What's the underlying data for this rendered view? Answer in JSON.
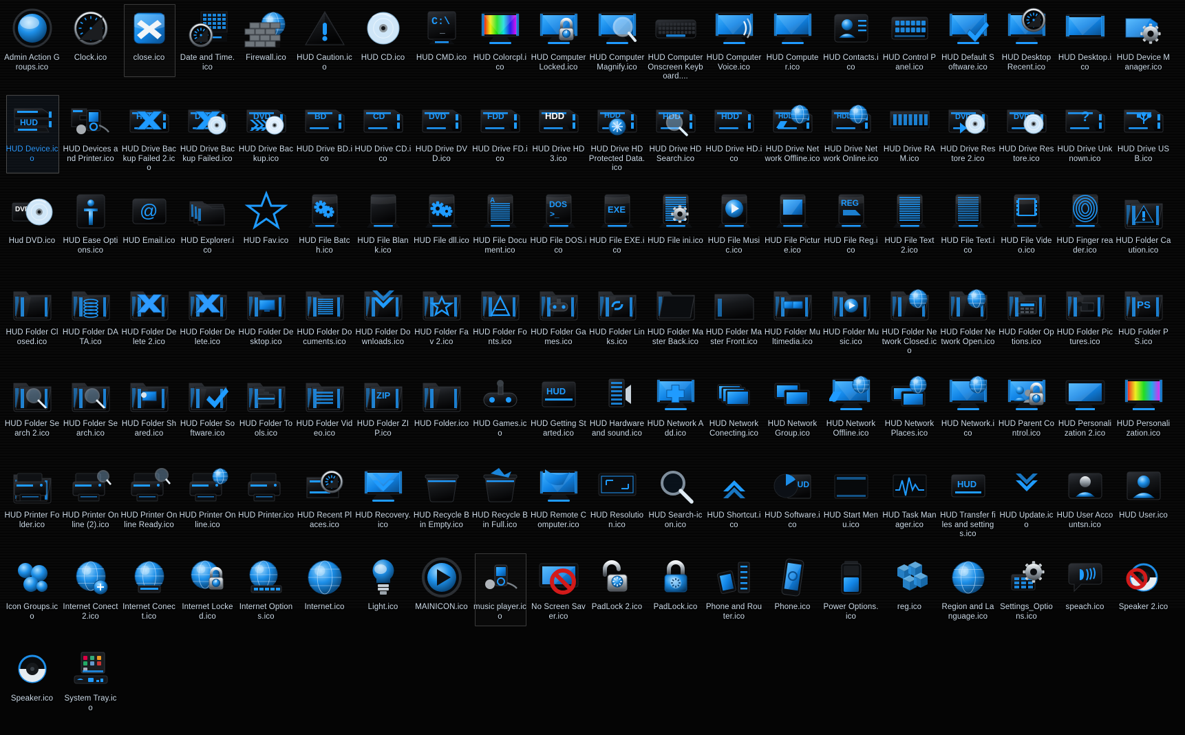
{
  "view": {
    "name": "icon-folder-grid",
    "background_color": "#060606",
    "label_color": "#cddbe8",
    "selected_label_color": "#2e9bff",
    "columns": 20,
    "rows": 7,
    "total_items": 140
  },
  "icons": [
    {
      "label": "Admin Action Groups.ico",
      "glyph": "orb-blue",
      "state": "normal"
    },
    {
      "label": "Clock.ico",
      "glyph": "clock",
      "state": "normal"
    },
    {
      "label": "close.ico",
      "glyph": "close-x",
      "state": "selected"
    },
    {
      "label": "Date and Time.ico",
      "glyph": "calendar-clock",
      "state": "normal"
    },
    {
      "label": "Firewall.ico",
      "glyph": "firewall-brick",
      "state": "normal"
    },
    {
      "label": "HUD Caution.ico",
      "glyph": "caution-triangle",
      "state": "normal"
    },
    {
      "label": "HUD CD.ico",
      "glyph": "disc",
      "state": "normal"
    },
    {
      "label": "HUD CMD.ico",
      "glyph": "cmd-prompt",
      "state": "normal"
    },
    {
      "label": "HUD Colorcpl.ico",
      "glyph": "monitor-rainbow",
      "state": "normal"
    },
    {
      "label": "HUD Computer Locked.ico",
      "glyph": "monitor-lock",
      "state": "normal"
    },
    {
      "label": "HUD Computer Magnify.ico",
      "glyph": "monitor-magnify",
      "state": "normal"
    },
    {
      "label": "HUD Computer Onscreen Keyboard....",
      "glyph": "keyboard",
      "state": "normal"
    },
    {
      "label": "HUD Computer Voice.ico",
      "glyph": "monitor-voice",
      "state": "normal"
    },
    {
      "label": "HUD Computer.ico",
      "glyph": "monitor",
      "state": "normal"
    },
    {
      "label": "HUD Contacts.ico",
      "glyph": "contacts",
      "state": "normal"
    },
    {
      "label": "HUD Control Panel.ico",
      "glyph": "control-panel",
      "state": "normal"
    },
    {
      "label": "HUD Default Software.ico",
      "glyph": "monitor-check",
      "state": "normal"
    },
    {
      "label": "HUD Desktop Recent.ico",
      "glyph": "monitor-clock",
      "state": "normal"
    },
    {
      "label": "HUD Desktop.ico",
      "glyph": "monitor-plain",
      "state": "normal"
    },
    {
      "label": "HUD Device Manager.ico",
      "glyph": "device-gear",
      "state": "normal"
    },
    {
      "label": "HUD Device.ico",
      "glyph": "hud-device",
      "state": "active"
    },
    {
      "label": "HUD Devices and Printer.ico",
      "glyph": "devices-printer",
      "state": "normal"
    },
    {
      "label": "HUD Drive Backup Failed 2.ico",
      "glyph": "drive-hdd-x",
      "state": "normal"
    },
    {
      "label": "HUD Drive Backup Failed.ico",
      "glyph": "drive-dvd-x",
      "state": "normal"
    },
    {
      "label": "HUD Drive Backup.ico",
      "glyph": "drive-dvd-arrows",
      "state": "normal"
    },
    {
      "label": "HUD Drive BD.ico",
      "glyph": "drive-bd",
      "state": "normal"
    },
    {
      "label": "HUD Drive CD.ico",
      "glyph": "drive-cd",
      "state": "normal"
    },
    {
      "label": "HUD Drive DVD.ico",
      "glyph": "drive-dvd",
      "state": "normal"
    },
    {
      "label": "HUD Drive FD.ico",
      "glyph": "drive-fd",
      "state": "normal"
    },
    {
      "label": "HUD Drive HD 3.ico",
      "glyph": "drive-hdd3",
      "state": "normal"
    },
    {
      "label": "HUD Drive HD Protected Data.ico",
      "glyph": "drive-hdd-shield",
      "state": "normal"
    },
    {
      "label": "HUD Drive HD Search.ico",
      "glyph": "drive-hdd-search",
      "state": "normal"
    },
    {
      "label": "HUD Drive HD.ico",
      "glyph": "drive-hdd",
      "state": "normal"
    },
    {
      "label": "HUD Drive Network Offline.ico",
      "glyph": "drive-net-off",
      "state": "normal"
    },
    {
      "label": "HUD Drive Network Online.ico",
      "glyph": "drive-net-on",
      "state": "normal"
    },
    {
      "label": "HUD Drive RAM.ico",
      "glyph": "drive-ram",
      "state": "normal"
    },
    {
      "label": "HUD Drive Restore 2.ico",
      "glyph": "drive-restore2",
      "state": "normal"
    },
    {
      "label": "HUD Drive Restore.ico",
      "glyph": "drive-restore",
      "state": "normal"
    },
    {
      "label": "HUD Drive Unknown.ico",
      "glyph": "drive-unknown",
      "state": "normal"
    },
    {
      "label": "HUD Drive USB.ico",
      "glyph": "drive-usb",
      "state": "normal"
    },
    {
      "label": "Hud DVD.ico",
      "glyph": "dvd-disc",
      "state": "normal"
    },
    {
      "label": "HUD Ease Options.ico",
      "glyph": "ease-access",
      "state": "normal"
    },
    {
      "label": "HUD Email.ico",
      "glyph": "email-at",
      "state": "normal"
    },
    {
      "label": "HUD Explorer.ico",
      "glyph": "explorer-stack",
      "state": "normal"
    },
    {
      "label": "HUD Fav.ico",
      "glyph": "star",
      "state": "normal"
    },
    {
      "label": "HUD File Batch.ico",
      "glyph": "file-batch",
      "state": "normal"
    },
    {
      "label": "HUD File Blank.ico",
      "glyph": "file-blank",
      "state": "normal"
    },
    {
      "label": "HUD File dll.ico",
      "glyph": "file-dll",
      "state": "normal"
    },
    {
      "label": "HUD File Document.ico",
      "glyph": "file-doc",
      "state": "normal"
    },
    {
      "label": "HUD File DOS.ico",
      "glyph": "file-dos",
      "state": "normal"
    },
    {
      "label": "HUD File EXE.ico",
      "glyph": "file-exe",
      "state": "normal"
    },
    {
      "label": "HUD File ini.ico",
      "glyph": "file-ini",
      "state": "normal"
    },
    {
      "label": "HUD File Music.ico",
      "glyph": "file-music",
      "state": "normal"
    },
    {
      "label": "HUD File Picture.ico",
      "glyph": "file-picture",
      "state": "normal"
    },
    {
      "label": "HUD File Reg.ico",
      "glyph": "file-reg",
      "state": "normal"
    },
    {
      "label": "HUD File Text 2.ico",
      "glyph": "file-text2",
      "state": "normal"
    },
    {
      "label": "HUD File Text.ico",
      "glyph": "file-text",
      "state": "normal"
    },
    {
      "label": "HUD File Video.ico",
      "glyph": "file-video",
      "state": "normal"
    },
    {
      "label": "HUD Finger reader.ico",
      "glyph": "fingerprint",
      "state": "normal"
    },
    {
      "label": "HUD Folder Caution.ico",
      "glyph": "folder-caution",
      "state": "normal"
    },
    {
      "label": "HUD Folder Closed.ico",
      "glyph": "folder-closed",
      "state": "normal"
    },
    {
      "label": "HUD Folder DATA.ico",
      "glyph": "folder-data",
      "state": "normal"
    },
    {
      "label": "HUD Folder Delete 2.ico",
      "glyph": "folder-delete2",
      "state": "normal"
    },
    {
      "label": "HUD Folder Delete.ico",
      "glyph": "folder-delete",
      "state": "normal"
    },
    {
      "label": "HUD Folder Desktop.ico",
      "glyph": "folder-desktop",
      "state": "normal"
    },
    {
      "label": "HUD Folder Documents.ico",
      "glyph": "folder-documents",
      "state": "normal"
    },
    {
      "label": "HUD Folder Downloads.ico",
      "glyph": "folder-downloads",
      "state": "normal"
    },
    {
      "label": "HUD Folder Fav 2.ico",
      "glyph": "folder-fav",
      "state": "normal"
    },
    {
      "label": "HUD Folder Fonts.ico",
      "glyph": "folder-fonts",
      "state": "normal"
    },
    {
      "label": "HUD Folder Games.ico",
      "glyph": "folder-games",
      "state": "normal"
    },
    {
      "label": "HUD Folder Links.ico",
      "glyph": "folder-links",
      "state": "normal"
    },
    {
      "label": "HUD Folder Master Back.ico",
      "glyph": "folder-master-back",
      "state": "normal"
    },
    {
      "label": "HUD Folder Master Front.ico",
      "glyph": "folder-master-front",
      "state": "normal"
    },
    {
      "label": "HUD Folder Multimedia.ico",
      "glyph": "folder-multimedia",
      "state": "normal"
    },
    {
      "label": "HUD Folder Music.ico",
      "glyph": "folder-music",
      "state": "normal"
    },
    {
      "label": "HUD Folder Network Closed.ico",
      "glyph": "folder-net-closed",
      "state": "normal"
    },
    {
      "label": "HUD Folder Network Open.ico",
      "glyph": "folder-net-open",
      "state": "normal"
    },
    {
      "label": "HUD Folder Options.ico",
      "glyph": "folder-options",
      "state": "normal"
    },
    {
      "label": "HUD Folder Pictures.ico",
      "glyph": "folder-pictures",
      "state": "normal"
    },
    {
      "label": "HUD Folder PS.ico",
      "glyph": "folder-ps",
      "state": "normal"
    },
    {
      "label": "HUD Folder Search 2.ico",
      "glyph": "folder-search2",
      "state": "normal"
    },
    {
      "label": "HUD Folder Search.ico",
      "glyph": "folder-search",
      "state": "normal"
    },
    {
      "label": "HUD Folder Shared.ico",
      "glyph": "folder-shared",
      "state": "normal"
    },
    {
      "label": "HUD Folder Software.ico",
      "glyph": "folder-software",
      "state": "normal"
    },
    {
      "label": "HUD Folder Tools.ico",
      "glyph": "folder-tools",
      "state": "normal"
    },
    {
      "label": "HUD Folder Video.ico",
      "glyph": "folder-video",
      "state": "normal"
    },
    {
      "label": "HUD Folder ZIP.ico",
      "glyph": "folder-zip",
      "state": "normal"
    },
    {
      "label": "HUD Folder.ico",
      "glyph": "folder",
      "state": "normal"
    },
    {
      "label": "HUD Games.ico",
      "glyph": "gamepad",
      "state": "normal"
    },
    {
      "label": "HUD Getting Started.ico",
      "glyph": "getting-started",
      "state": "normal"
    },
    {
      "label": "HUD Hardware and sound.ico",
      "glyph": "hardware-sound",
      "state": "normal"
    },
    {
      "label": "HUD Network Add.ico",
      "glyph": "network-add",
      "state": "normal"
    },
    {
      "label": "HUD Network Conecting.ico",
      "glyph": "network-connecting",
      "state": "normal"
    },
    {
      "label": "HUD Network Group.ico",
      "glyph": "network-group",
      "state": "normal"
    },
    {
      "label": "HUD Network Offline.ico",
      "glyph": "network-offline",
      "state": "normal"
    },
    {
      "label": "HUD Network Places.ico",
      "glyph": "network-places",
      "state": "normal"
    },
    {
      "label": "HUD Network.ico",
      "glyph": "network",
      "state": "normal"
    },
    {
      "label": "HUD Parent Control.ico",
      "glyph": "parent-control",
      "state": "normal"
    },
    {
      "label": "HUD Personalization 2.ico",
      "glyph": "personalization2",
      "state": "normal"
    },
    {
      "label": "HUD Personalization.ico",
      "glyph": "personalization",
      "state": "normal"
    },
    {
      "label": "HUD Printer Folder.ico",
      "glyph": "printer-folder",
      "state": "normal"
    },
    {
      "label": "HUD Printer Online (2).ico",
      "glyph": "printer-online2",
      "state": "normal"
    },
    {
      "label": "HUD Printer Online Ready.ico",
      "glyph": "printer-ready",
      "state": "normal"
    },
    {
      "label": "HUD Printer Online.ico",
      "glyph": "printer-online",
      "state": "normal"
    },
    {
      "label": "HUD Printer.ico",
      "glyph": "printer",
      "state": "normal"
    },
    {
      "label": "HUD Recent Places.ico",
      "glyph": "recent-places",
      "state": "normal"
    },
    {
      "label": "HUD Recovery.ico",
      "glyph": "recovery",
      "state": "normal"
    },
    {
      "label": "HUD Recycle Bin Empty.ico",
      "glyph": "recycle-empty",
      "state": "normal"
    },
    {
      "label": "HUD Recycle Bin Full.ico",
      "glyph": "recycle-full",
      "state": "normal"
    },
    {
      "label": "HUD Remote Computer.ico",
      "glyph": "remote-computer",
      "state": "normal"
    },
    {
      "label": "HUD Resolution.ico",
      "glyph": "resolution",
      "state": "normal"
    },
    {
      "label": "HUD Search-icon.ico",
      "glyph": "search",
      "state": "normal"
    },
    {
      "label": "HUD Shortcut.ico",
      "glyph": "shortcut-chevrons",
      "state": "normal"
    },
    {
      "label": "HUD Software.ico",
      "glyph": "software-disc",
      "state": "normal"
    },
    {
      "label": "HUD Start Menu.ico",
      "glyph": "start-menu",
      "state": "normal"
    },
    {
      "label": "HUD Task Manager.ico",
      "glyph": "task-manager",
      "state": "normal"
    },
    {
      "label": "HUD Transfer files and settings.ico",
      "glyph": "transfer",
      "state": "normal"
    },
    {
      "label": "HUD Update.ico",
      "glyph": "update-chevrons",
      "state": "normal"
    },
    {
      "label": "HUD User Accountsn.ico",
      "glyph": "user-accounts",
      "state": "normal"
    },
    {
      "label": "HUD User.ico",
      "glyph": "user",
      "state": "normal"
    },
    {
      "label": "Icon Groups.ico",
      "glyph": "icon-groups",
      "state": "normal"
    },
    {
      "label": "Internet Conect 2.ico",
      "glyph": "internet-connect2",
      "state": "normal"
    },
    {
      "label": "Internet Conect.ico",
      "glyph": "internet-connect",
      "state": "normal"
    },
    {
      "label": "Internet Locked.ico",
      "glyph": "internet-locked",
      "state": "normal"
    },
    {
      "label": "Internet Options.ico",
      "glyph": "internet-options",
      "state": "normal"
    },
    {
      "label": "Internet.ico",
      "glyph": "internet-globe",
      "state": "normal"
    },
    {
      "label": "Light.ico",
      "glyph": "lightbulb",
      "state": "normal"
    },
    {
      "label": "MAINICON.ico",
      "glyph": "play-orb",
      "state": "normal"
    },
    {
      "label": "music player.ico",
      "glyph": "music-player",
      "state": "selected"
    },
    {
      "label": "No Screen Saver.ico",
      "glyph": "no-screensaver",
      "state": "normal"
    },
    {
      "label": "PadLock 2.ico",
      "glyph": "padlock-open",
      "state": "normal"
    },
    {
      "label": "PadLock.ico",
      "glyph": "padlock-closed",
      "state": "normal"
    },
    {
      "label": "Phone and Router.ico",
      "glyph": "phone-router",
      "state": "normal"
    },
    {
      "label": "Phone.ico",
      "glyph": "phone",
      "state": "normal"
    },
    {
      "label": "Power Options.ico",
      "glyph": "battery",
      "state": "normal"
    },
    {
      "label": "reg.ico",
      "glyph": "reg-blocks",
      "state": "normal"
    },
    {
      "label": "Region and Language.ico",
      "glyph": "region-globe",
      "state": "normal"
    },
    {
      "label": "Settings_Options.ico",
      "glyph": "settings-gear",
      "state": "normal"
    },
    {
      "label": "speach.ico",
      "glyph": "speech",
      "state": "normal"
    },
    {
      "label": "Speaker 2.ico",
      "glyph": "speaker-muted",
      "state": "normal"
    },
    {
      "label": "Speaker.ico",
      "glyph": "speaker",
      "state": "normal"
    },
    {
      "label": "System Tray.ico",
      "glyph": "system-tray",
      "state": "normal"
    }
  ]
}
